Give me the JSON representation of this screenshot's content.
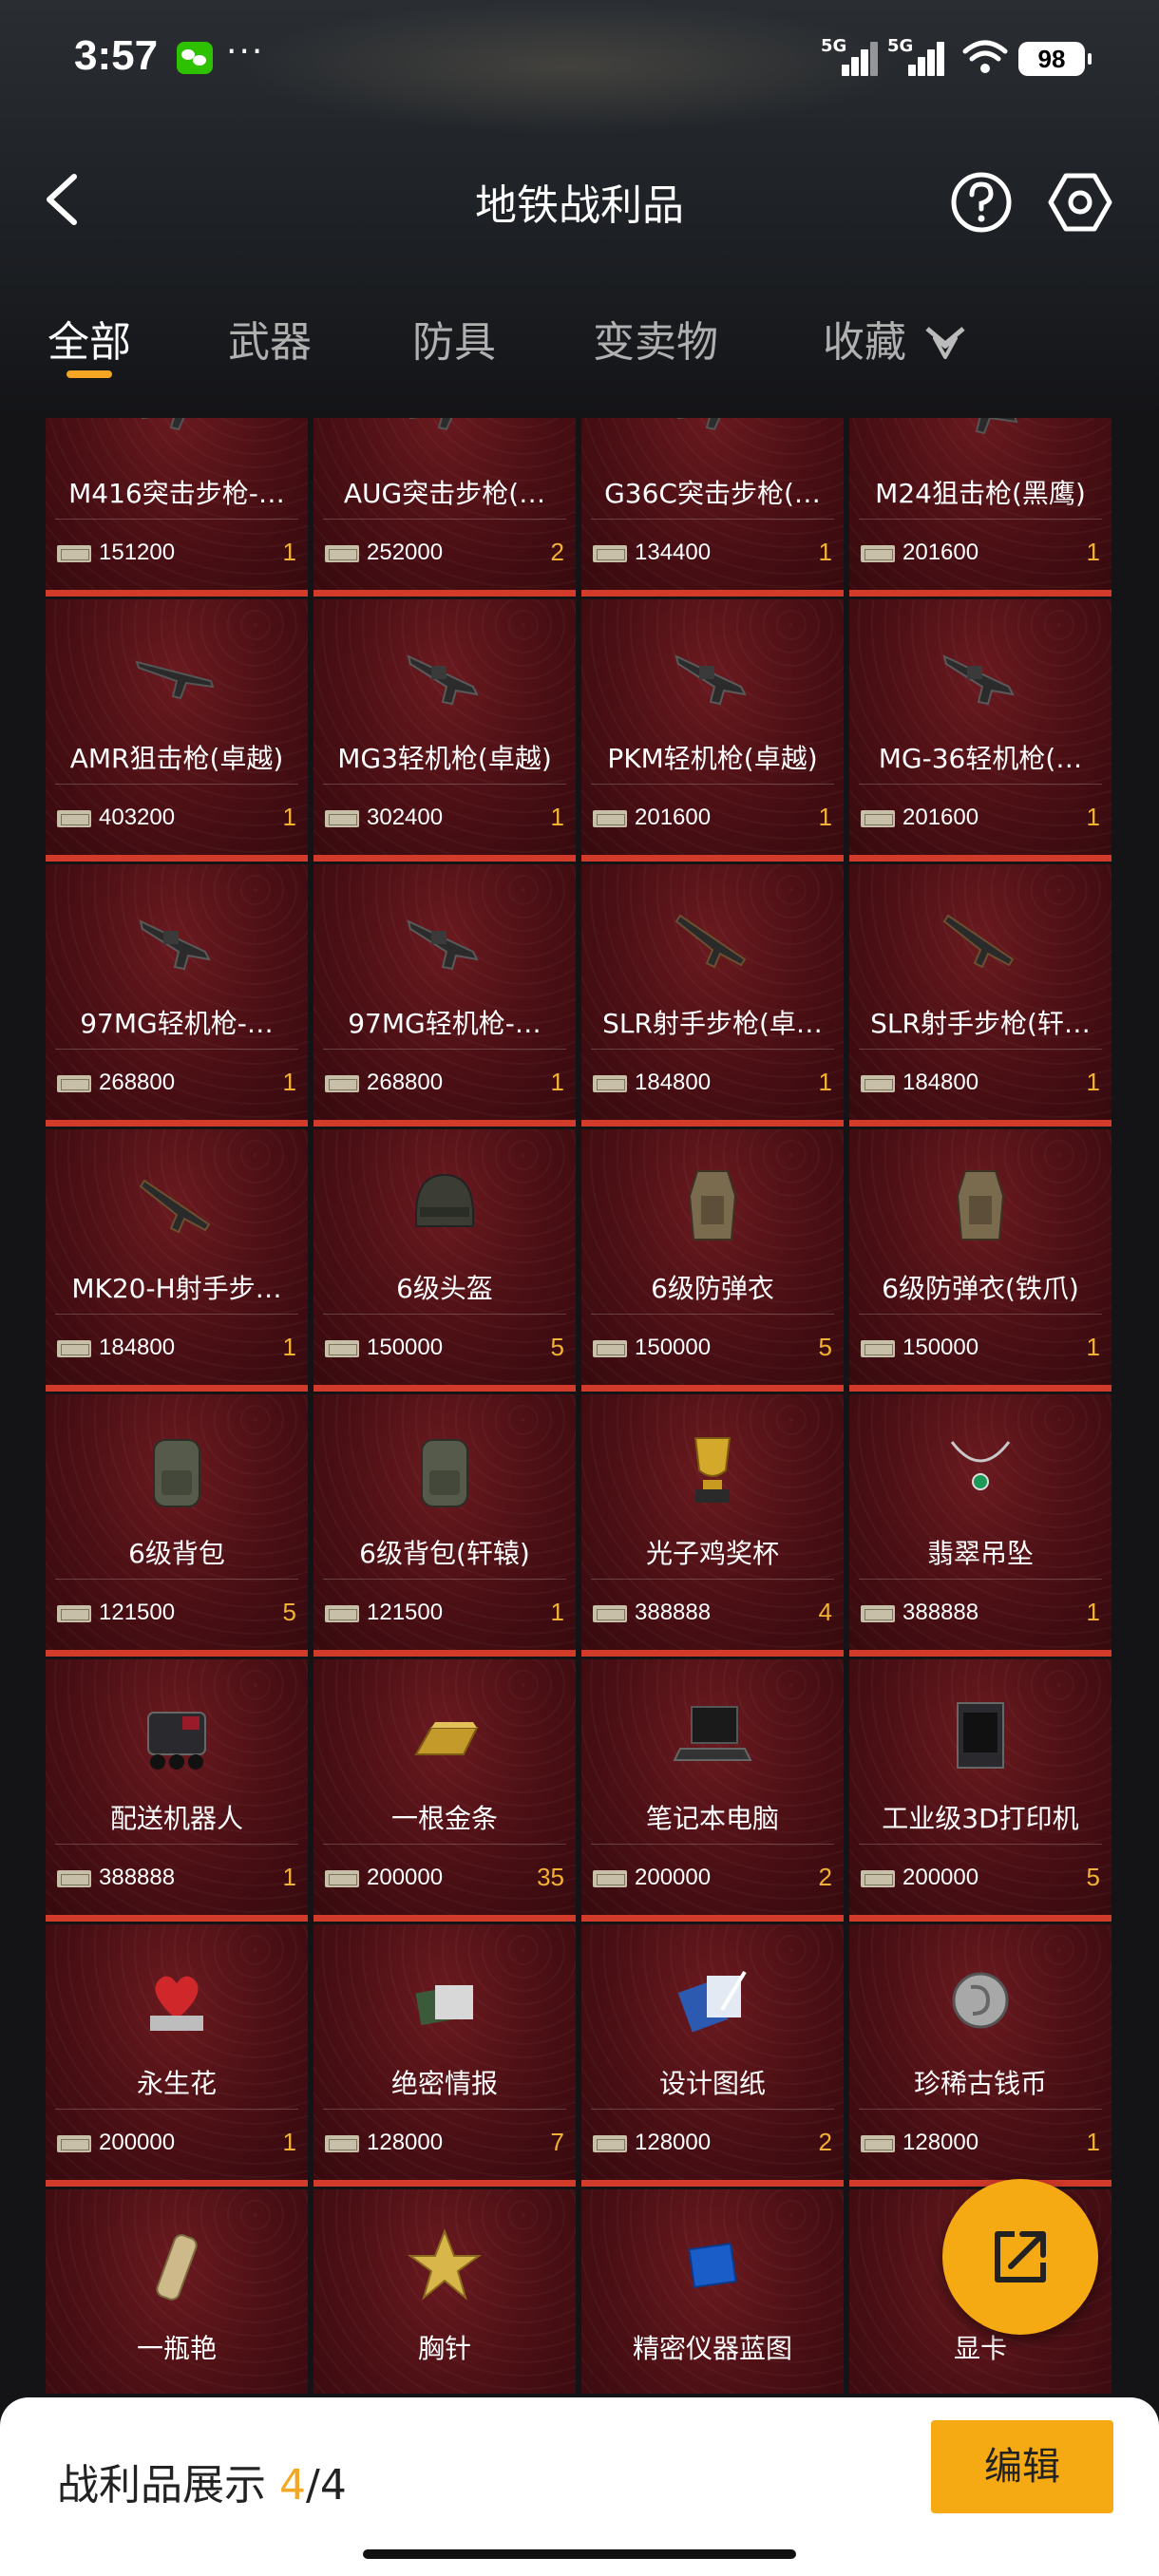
{
  "status_bar": {
    "time": "3:57",
    "more": "···",
    "signal1_tag": "5G",
    "signal2_tag": "5G",
    "battery": "98"
  },
  "header": {
    "title": "地铁战利品"
  },
  "tabs": [
    {
      "label": "全部",
      "active": true
    },
    {
      "label": "武器"
    },
    {
      "label": "防具"
    },
    {
      "label": "变卖物"
    },
    {
      "label": "收藏"
    }
  ],
  "items": [
    {
      "name": "M416突击步枪-…",
      "price": "151200",
      "qty": "1",
      "icon": "rifle-icon"
    },
    {
      "name": "AUG突击步枪(…",
      "price": "252000",
      "qty": "2",
      "icon": "rifle-icon"
    },
    {
      "name": "G36C突击步枪(…",
      "price": "134400",
      "qty": "1",
      "icon": "rifle-icon"
    },
    {
      "name": "M24狙击枪(黑鹰)",
      "price": "201600",
      "qty": "1",
      "icon": "sniper-rifle-icon"
    },
    {
      "name": "AMR狙击枪(卓越)",
      "price": "403200",
      "qty": "1",
      "icon": "sniper-rifle-icon"
    },
    {
      "name": "MG3轻机枪(卓越)",
      "price": "302400",
      "qty": "1",
      "icon": "machine-gun-icon"
    },
    {
      "name": "PKM轻机枪(卓越)",
      "price": "201600",
      "qty": "1",
      "icon": "machine-gun-icon"
    },
    {
      "name": "MG-36轻机枪(…",
      "price": "201600",
      "qty": "1",
      "icon": "machine-gun-icon"
    },
    {
      "name": "97MG轻机枪-…",
      "price": "268800",
      "qty": "1",
      "icon": "machine-gun-icon"
    },
    {
      "name": "97MG轻机枪-…",
      "price": "268800",
      "qty": "1",
      "icon": "machine-gun-icon"
    },
    {
      "name": "SLR射手步枪(卓…",
      "price": "184800",
      "qty": "1",
      "icon": "marksman-rifle-icon"
    },
    {
      "name": "SLR射手步枪(轩…",
      "price": "184800",
      "qty": "1",
      "icon": "marksman-rifle-icon"
    },
    {
      "name": "MK20-H射手步…",
      "price": "184800",
      "qty": "1",
      "icon": "marksman-rifle-icon"
    },
    {
      "name": "6级头盔",
      "price": "150000",
      "qty": "5",
      "icon": "helmet-icon"
    },
    {
      "name": "6级防弹衣",
      "price": "150000",
      "qty": "5",
      "icon": "body-armor-icon"
    },
    {
      "name": "6级防弹衣(铁爪)",
      "price": "150000",
      "qty": "1",
      "icon": "body-armor-icon"
    },
    {
      "name": "6级背包",
      "price": "121500",
      "qty": "5",
      "icon": "backpack-icon"
    },
    {
      "name": "6级背包(轩辕)",
      "price": "121500",
      "qty": "1",
      "icon": "backpack-icon"
    },
    {
      "name": "光子鸡奖杯",
      "price": "388888",
      "qty": "4",
      "icon": "trophy-icon"
    },
    {
      "name": "翡翠吊坠",
      "price": "388888",
      "qty": "1",
      "icon": "pendant-icon"
    },
    {
      "name": "配送机器人",
      "price": "388888",
      "qty": "1",
      "icon": "robot-icon"
    },
    {
      "name": "一根金条",
      "price": "200000",
      "qty": "35",
      "icon": "gold-bar-icon"
    },
    {
      "name": "笔记本电脑",
      "price": "200000",
      "qty": "2",
      "icon": "laptop-icon"
    },
    {
      "name": "工业级3D打印机",
      "price": "200000",
      "qty": "5",
      "icon": "3d-printer-icon"
    },
    {
      "name": "永生花",
      "price": "200000",
      "qty": "1",
      "icon": "preserved-flower-icon"
    },
    {
      "name": "绝密情报",
      "price": "128000",
      "qty": "7",
      "icon": "intel-documents-icon"
    },
    {
      "name": "设计图纸",
      "price": "128000",
      "qty": "2",
      "icon": "blueprint-icon"
    },
    {
      "name": "珍稀古钱币",
      "price": "128000",
      "qty": "1",
      "icon": "ancient-coin-icon"
    },
    {
      "name": "一瓶艳",
      "price": "",
      "qty": "",
      "icon": "bottle-icon"
    },
    {
      "name": "胸针",
      "price": "",
      "qty": "",
      "icon": "brooch-icon"
    },
    {
      "name": "精密仪器蓝图",
      "price": "",
      "qty": "",
      "icon": "precision-blueprint-icon"
    },
    {
      "name": "显卡",
      "price": "",
      "qty": "",
      "icon": "graphics-card-icon"
    }
  ],
  "bottom_bar": {
    "label": "战利品展示 ",
    "count": "4",
    "total": "/4",
    "edit_label": "编辑"
  },
  "colors": {
    "accent": "#f5a913",
    "card_bg": "#4a0f14",
    "card_border": "#d23a2a",
    "qty": "#f2b233"
  }
}
